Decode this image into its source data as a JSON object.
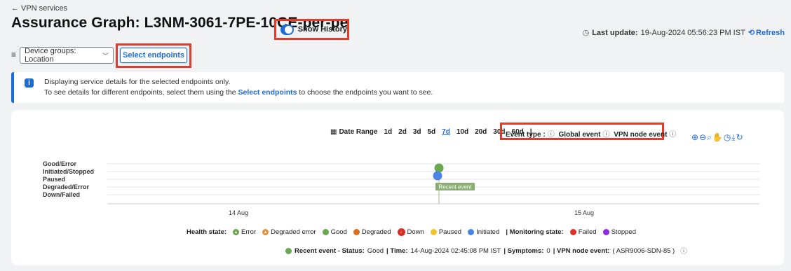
{
  "header": {
    "back_label": "VPN services",
    "title": "Assurance Graph: L3NM-3061-7PE-10CE-per-pe",
    "show_history_label": "Show History",
    "last_update_label": "Last update:",
    "last_update_value": "19-Aug-2024 05:56:23 PM IST",
    "refresh_label": "Refresh"
  },
  "filters": {
    "device_groups_label": "Device groups: Location",
    "select_endpoints_label": "Select endpoints"
  },
  "info": {
    "line1": "Displaying service details for the selected endpoints only.",
    "line2_pre": "To see details for different endpoints, select them using the ",
    "line2_link": "Select endpoints",
    "line2_post": " to choose the endpoints you want to see."
  },
  "toolbar": {
    "date_range_label": "Date Range",
    "ranges": [
      "1d",
      "2d",
      "3d",
      "5d",
      "7d",
      "10d",
      "20d",
      "30d",
      "60d"
    ],
    "selected_range": "7d",
    "separator": "|",
    "event_type_label": "Event type :",
    "global_event_label": "Global event",
    "vpn_node_event_label": "VPN node event"
  },
  "chart_data": {
    "type": "scatter",
    "y_categories": [
      "Good/Error",
      "Initiated/Stopped",
      "Paused",
      "Degraded/Error",
      "Down/Failed"
    ],
    "x_tick_labels": [
      "14 Aug",
      "15 Aug"
    ],
    "series": [
      {
        "state": "Good/Error",
        "x": "14-Aug-2024 02:45 PM",
        "color": "#6aa84f"
      },
      {
        "state": "Initiated/Stopped",
        "x": "14-Aug-2024 02:45 PM",
        "color": "#4a86e8"
      }
    ],
    "annotation": "Recent event",
    "grid": true
  },
  "legend": {
    "health_state_label": "Health state:",
    "health_items": [
      {
        "label": "Error",
        "color": "#6aa84f",
        "icon": "error-triangle-icon"
      },
      {
        "label": "Degraded error",
        "color": "#e69138",
        "icon": "degraded-error-triangle-icon"
      },
      {
        "label": "Good",
        "color": "#6aa84f"
      },
      {
        "label": "Degraded",
        "color": "#e06c1a"
      },
      {
        "label": "Down",
        "color": "#d92d20",
        "icon": "down-arrow-icon"
      },
      {
        "label": "Paused",
        "color": "#f1c232"
      },
      {
        "label": "Initiated",
        "color": "#4a86e8"
      }
    ],
    "monitoring_state_label": "| Monitoring state:",
    "monitoring_items": [
      {
        "label": "Failed",
        "color": "#e0322a"
      },
      {
        "label": "Stopped",
        "color": "#8e2de2"
      }
    ]
  },
  "status": {
    "label": "Recent event - Status:",
    "status_value": "Good",
    "time_label": "| Time:",
    "time_value": "14-Aug-2024 02:45:08 PM IST",
    "symptoms_label": "| Symptoms:",
    "symptoms_value": "0",
    "vpn_label": "| VPN node event:",
    "vpn_value": "( ASR9006-SDN-85 )",
    "dot_color": "#6aa84f"
  }
}
